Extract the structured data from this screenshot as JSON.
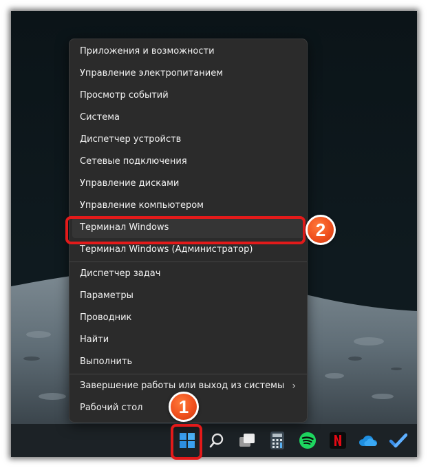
{
  "context_menu": {
    "items": [
      {
        "label": "Приложения и возможности"
      },
      {
        "label": "Управление электропитанием"
      },
      {
        "label": "Просмотр событий"
      },
      {
        "label": "Система"
      },
      {
        "label": "Диспетчер устройств"
      },
      {
        "label": "Сетевые подключения"
      },
      {
        "label": "Управление дисками"
      },
      {
        "label": "Управление компьютером"
      },
      {
        "label": "Терминал Windows"
      },
      {
        "label": "Терминал Windows (Администратор)"
      },
      {
        "label": "Диспетчер задач"
      },
      {
        "label": "Параметры"
      },
      {
        "label": "Проводник"
      },
      {
        "label": "Найти"
      },
      {
        "label": "Выполнить"
      },
      {
        "label": "Завершение работы или выход из системы",
        "submenu_icon": "chevron-right-icon"
      },
      {
        "label": "Рабочий стол"
      }
    ],
    "highlighted_item": "Терминал Windows"
  },
  "taskbar": {
    "icons": [
      "windows-start-icon",
      "search-icon",
      "task-view-icon",
      "calculator-icon",
      "spotify-icon",
      "netflix-icon",
      "onedrive-icon",
      "todo-checkmark-icon"
    ]
  },
  "annotations": {
    "step1": "1",
    "step2": "2",
    "color": "#e31a1a"
  }
}
